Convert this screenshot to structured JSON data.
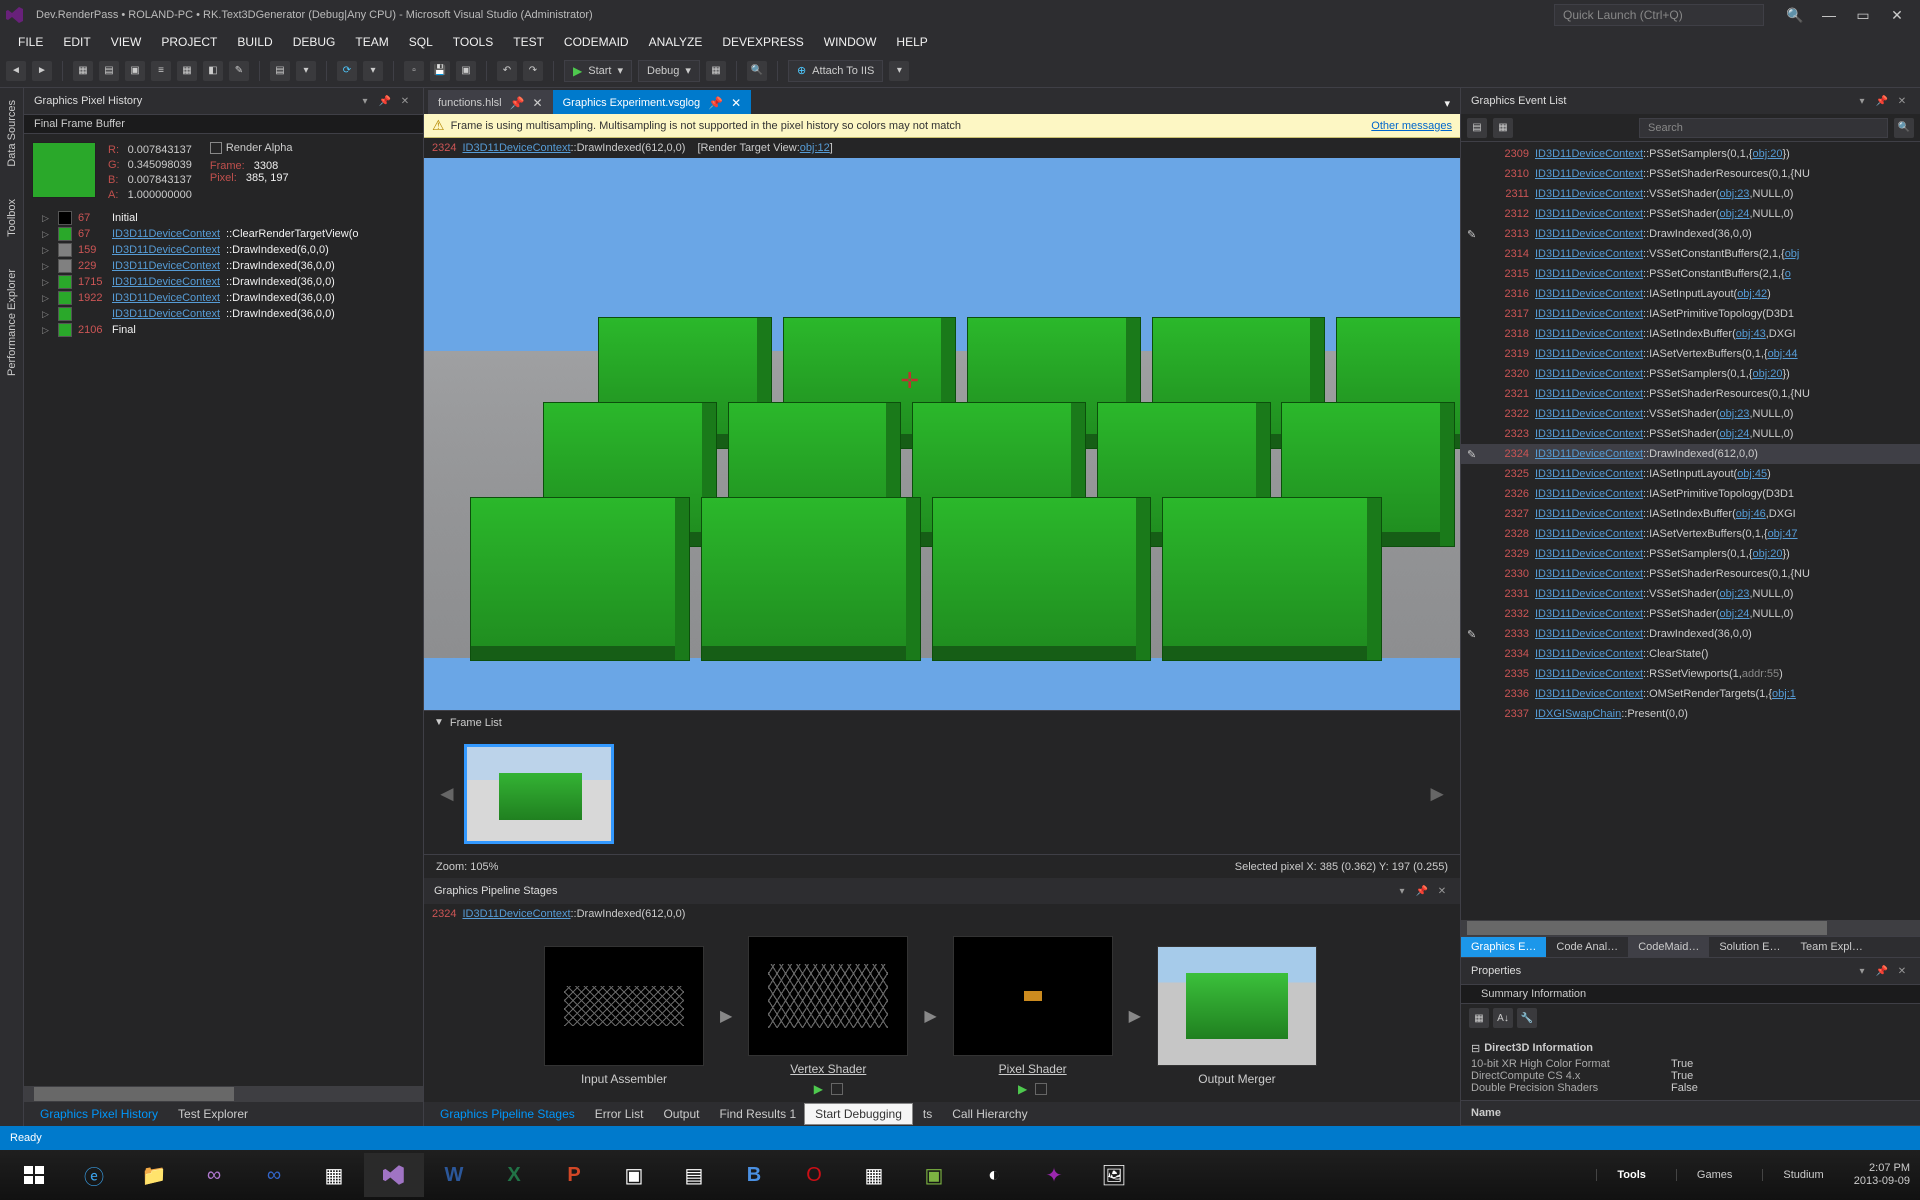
{
  "title": "Dev.RenderPass • ROLAND-PC • RK.Text3DGenerator (Debug|Any CPU) - Microsoft Visual Studio (Administrator)",
  "quick_launch_ph": "Quick Launch (Ctrl+Q)",
  "menu": [
    "FILE",
    "EDIT",
    "VIEW",
    "PROJECT",
    "BUILD",
    "DEBUG",
    "TEAM",
    "SQL",
    "TOOLS",
    "TEST",
    "CODEMAID",
    "ANALYZE",
    "DEVEXPRESS",
    "WINDOW",
    "HELP"
  ],
  "toolbar": {
    "start": "Start",
    "config": "Debug",
    "attach": "Attach To IIS"
  },
  "side_tabs": [
    "Data Sources",
    "Toolbox",
    "Performance Explorer"
  ],
  "pixel_history": {
    "title": "Graphics Pixel History",
    "ffb_title": "Final Frame Buffer",
    "render_alpha": "Render Alpha",
    "rgba_labels": [
      "R:",
      "G:",
      "B:",
      "A:"
    ],
    "rgba": [
      "0.007843137",
      "0.345098039",
      "0.007843137",
      "1.000000000"
    ],
    "frame_lab": "Frame:",
    "frame": "3308",
    "pixel_lab": "Pixel:",
    "pixel": "385, 197",
    "rows": [
      {
        "c": "#000000",
        "n": "67",
        "t": "Initial",
        "link": false
      },
      {
        "c": "#2aa82a",
        "n": "67",
        "t": "ID3D11DeviceContext",
        "rest": "::ClearRenderTargetView(o",
        "link": true
      },
      {
        "c": "#808080",
        "n": "159",
        "t": "ID3D11DeviceContext",
        "rest": "::DrawIndexed(6,0,0)",
        "link": true
      },
      {
        "c": "#808080",
        "n": "229",
        "t": "ID3D11DeviceContext",
        "rest": "::DrawIndexed(36,0,0)",
        "link": true
      },
      {
        "c": "#2aa82a",
        "n": "1715",
        "t": "ID3D11DeviceContext",
        "rest": "::DrawIndexed(36,0,0)",
        "link": true
      },
      {
        "c": "#2aa82a",
        "n": "1922",
        "t": "ID3D11DeviceContext",
        "rest": "::DrawIndexed(36,0,0)",
        "link": true
      },
      {
        "c": "#2aa82a",
        "n": "",
        "t": "ID3D11DeviceContext",
        "rest": "::DrawIndexed(36,0,0)",
        "link": true
      },
      {
        "c": "#2aa82a",
        "n": "2106",
        "t": "Final",
        "link": false
      }
    ]
  },
  "tabs": [
    {
      "label": "functions.hlsl",
      "active": false
    },
    {
      "label": "Graphics Experiment.vsglog",
      "active": true
    }
  ],
  "info_bar": {
    "text": "Frame is using multisampling. Multisampling is not supported in the pixel history so colors may not match",
    "other": "Other messages"
  },
  "draw_line": {
    "n": "2324",
    "ctx": "ID3D11DeviceContext",
    "call": "::DrawIndexed(612,0,0)",
    "rt": "[Render Target View:",
    "obj": "obj:12",
    "end": "]"
  },
  "frame_list_lab": "Frame List",
  "zoom": "Zoom: 105%",
  "selected_pixel": "Selected pixel X: 385 (0.362) Y: 197 (0.255)",
  "pipeline": {
    "title": "Graphics Pipeline Stages",
    "draw_n": "2324",
    "draw_ctx": "ID3D11DeviceContext",
    "draw_call": "::DrawIndexed(612,0,0)",
    "stages": [
      "Input Assembler",
      "Vertex Shader",
      "Pixel Shader",
      "Output Merger"
    ]
  },
  "event_list": {
    "title": "Graphics Event List",
    "search_ph": "Search",
    "rows": [
      {
        "n": "2309",
        "c": "ID3D11DeviceContext",
        "r": "::PSSetSamplers(0,1,{",
        "o": "obj:20",
        "e": "})"
      },
      {
        "n": "2310",
        "c": "ID3D11DeviceContext",
        "r": "::PSSetShaderResources(0,1,{NU"
      },
      {
        "n": "2311",
        "c": "ID3D11DeviceContext",
        "r": "::VSSetShader(",
        "o": "obj:23",
        "e": ",NULL,0)"
      },
      {
        "n": "2312",
        "c": "ID3D11DeviceContext",
        "r": "::PSSetShader(",
        "o": "obj:24",
        "e": ",NULL,0)"
      },
      {
        "n": "2313",
        "c": "ID3D11DeviceContext",
        "r": "::DrawIndexed(36,0,0)",
        "pen": true
      },
      {
        "n": "2314",
        "c": "ID3D11DeviceContext",
        "r": "::VSSetConstantBuffers(2,1,{",
        "o": "obj"
      },
      {
        "n": "2315",
        "c": "ID3D11DeviceContext",
        "r": "::PSSetConstantBuffers(2,1,{",
        "o": "o"
      },
      {
        "n": "2316",
        "c": "ID3D11DeviceContext",
        "r": "::IASetInputLayout(",
        "o": "obj:42",
        "e": ")"
      },
      {
        "n": "2317",
        "c": "ID3D11DeviceContext",
        "r": "::IASetPrimitiveTopology(D3D1"
      },
      {
        "n": "2318",
        "c": "ID3D11DeviceContext",
        "r": "::IASetIndexBuffer(",
        "o": "obj:43",
        "e": ",DXGI"
      },
      {
        "n": "2319",
        "c": "ID3D11DeviceContext",
        "r": "::IASetVertexBuffers(0,1,{",
        "o": "obj:44"
      },
      {
        "n": "2320",
        "c": "ID3D11DeviceContext",
        "r": "::PSSetSamplers(0,1,{",
        "o": "obj:20",
        "e": "})"
      },
      {
        "n": "2321",
        "c": "ID3D11DeviceContext",
        "r": "::PSSetShaderResources(0,1,{NU"
      },
      {
        "n": "2322",
        "c": "ID3D11DeviceContext",
        "r": "::VSSetShader(",
        "o": "obj:23",
        "e": ",NULL,0)"
      },
      {
        "n": "2323",
        "c": "ID3D11DeviceContext",
        "r": "::PSSetShader(",
        "o": "obj:24",
        "e": ",NULL,0)"
      },
      {
        "n": "2324",
        "c": "ID3D11DeviceContext",
        "r": "::DrawIndexed(612,0,0)",
        "pen": true,
        "sel": true
      },
      {
        "n": "2325",
        "c": "ID3D11DeviceContext",
        "r": "::IASetInputLayout(",
        "o": "obj:45",
        "e": ")"
      },
      {
        "n": "2326",
        "c": "ID3D11DeviceContext",
        "r": "::IASetPrimitiveTopology(D3D1"
      },
      {
        "n": "2327",
        "c": "ID3D11DeviceContext",
        "r": "::IASetIndexBuffer(",
        "o": "obj:46",
        "e": ",DXGI"
      },
      {
        "n": "2328",
        "c": "ID3D11DeviceContext",
        "r": "::IASetVertexBuffers(0,1,{",
        "o": "obj:47"
      },
      {
        "n": "2329",
        "c": "ID3D11DeviceContext",
        "r": "::PSSetSamplers(0,1,{",
        "o": "obj:20",
        "e": "})"
      },
      {
        "n": "2330",
        "c": "ID3D11DeviceContext",
        "r": "::PSSetShaderResources(0,1,{NU"
      },
      {
        "n": "2331",
        "c": "ID3D11DeviceContext",
        "r": "::VSSetShader(",
        "o": "obj:23",
        "e": ",NULL,0)"
      },
      {
        "n": "2332",
        "c": "ID3D11DeviceContext",
        "r": "::PSSetShader(",
        "o": "obj:24",
        "e": ",NULL,0)"
      },
      {
        "n": "2333",
        "c": "ID3D11DeviceContext",
        "r": "::DrawIndexed(36,0,0)",
        "pen": true
      },
      {
        "n": "2334",
        "c": "ID3D11DeviceContext",
        "r": "::ClearState()"
      },
      {
        "n": "2335",
        "c": "ID3D11DeviceContext",
        "r": "::RSSetViewports(1,",
        "addr": "addr:55",
        "e": ")"
      },
      {
        "n": "2336",
        "c": "ID3D11DeviceContext",
        "r": "::OMSetRenderTargets(1,{",
        "o": "obj:1"
      },
      {
        "n": "2337",
        "c": "IDXGISwapChain",
        "r": "::Present(0,0)"
      }
    ],
    "tabs": [
      "Graphics E…",
      "Code Anal…",
      "CodeMaid…",
      "Solution E…",
      "Team Expl…"
    ]
  },
  "properties": {
    "title": "Properties",
    "summary": "Summary Information",
    "section": "Direct3D Information",
    "rows": [
      {
        "k": "10-bit XR High Color Format",
        "v": "True"
      },
      {
        "k": "DirectCompute CS 4.x",
        "v": "True"
      },
      {
        "k": "Double Precision Shaders",
        "v": "False"
      }
    ],
    "name_lab": "Name"
  },
  "bottom_left_tabs": [
    "Graphics Pixel History",
    "Test Explorer"
  ],
  "bottom_center_tabs": [
    "Graphics Pipeline Stages",
    "Error List",
    "Output",
    "Find Results 1"
  ],
  "debug_tooltip": "Start Debugging",
  "bottom_center_tabs_after": [
    "ts",
    "Call Hierarchy"
  ],
  "status": "Ready",
  "tray": {
    "groups": [
      "Tools",
      "Games",
      "Studium"
    ],
    "time": "2:07 PM",
    "date": "2013-09-09"
  }
}
